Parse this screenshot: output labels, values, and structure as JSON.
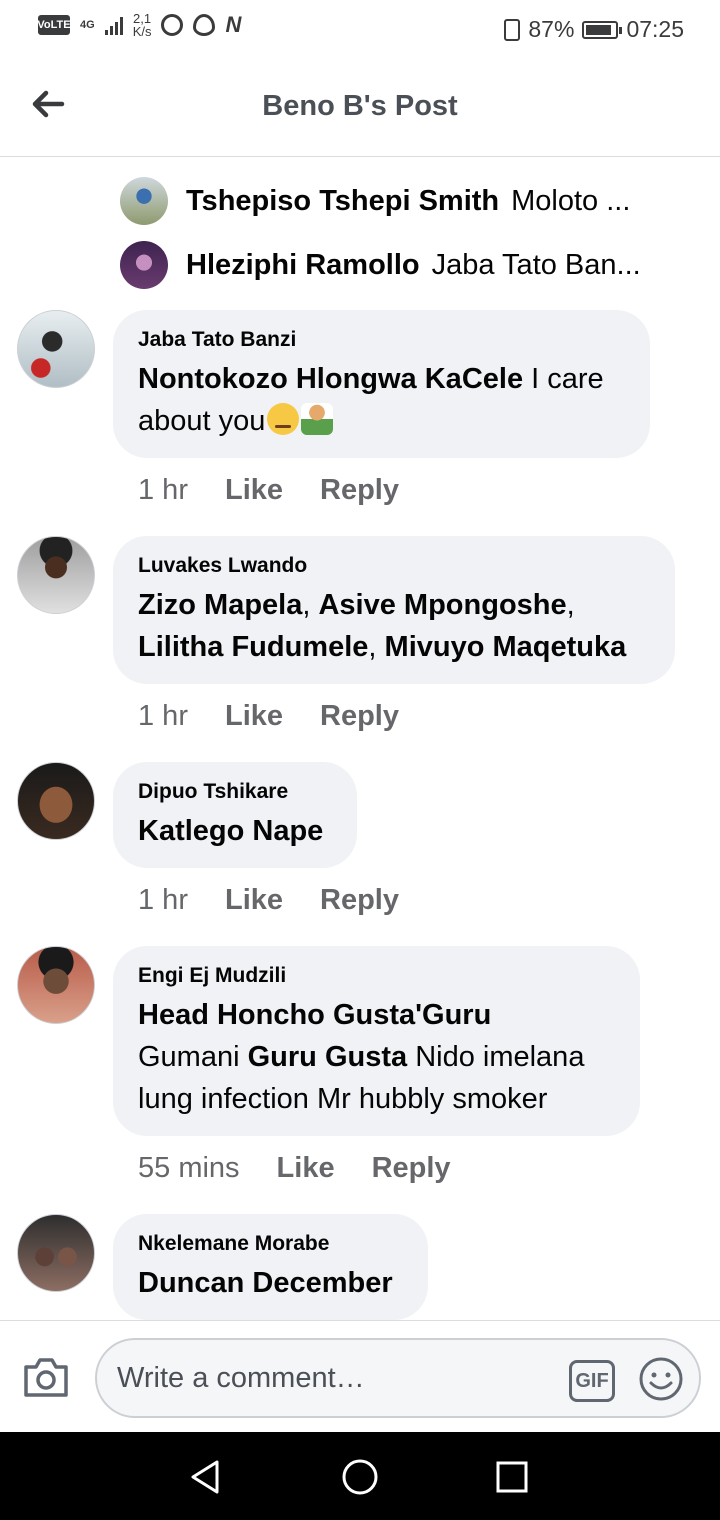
{
  "status_bar": {
    "volte": "VoLTE",
    "network": "4G",
    "speed": "2,1",
    "speed_unit": "K/s",
    "n_label": "N",
    "battery": "87%",
    "time": "07:25"
  },
  "header": {
    "title": "Beno B's Post"
  },
  "reply_previews": [
    {
      "name": "Tshepiso Tshepi Smith",
      "text": "Moloto ..."
    },
    {
      "name": "Hleziphi Ramollo",
      "text": "Jaba Tato Ban..."
    }
  ],
  "comments": [
    {
      "author": "Jaba Tato Banzi",
      "mention": "Nontokozo Hlongwa KaCele",
      "text": "I care about you",
      "time": "1 hr",
      "like": "Like",
      "reply": "Reply"
    },
    {
      "author": "Luvakes Lwando",
      "mentions": [
        "Zizo Mapela",
        "Asive Mpongoshe",
        "Lilitha Fudumele",
        "Mivuyo Maqetuka"
      ],
      "sep": ",",
      "time": "1 hr",
      "like": "Like",
      "reply": "Reply"
    },
    {
      "author": "Dipuo Tshikare",
      "mention": "Katlego Nape",
      "time": "1 hr",
      "like": "Like",
      "reply": "Reply"
    },
    {
      "author": "Engi Ej Mudzili",
      "mention": "Head Honcho Gusta'Guru",
      "text_a": "Gumani",
      "mention_b": "Guru Gusta",
      "text_b": "Nido imelana lung infection Mr hubbly smoker",
      "time": "55 mins",
      "like": "Like",
      "reply": "Reply"
    },
    {
      "author": "Nkelemane Morabe",
      "mention": "Duncan December"
    }
  ],
  "composer": {
    "placeholder": "Write a comment…",
    "gif_label": "GIF"
  },
  "icons": {
    "back": "back-arrow-icon",
    "camera": "camera-icon",
    "emoji": "smiley-icon",
    "nav": [
      "back-triangle-icon",
      "home-circle-icon",
      "recents-square-icon"
    ]
  },
  "colors": {
    "bubble": "#f0f2f5",
    "meta": "#65676b",
    "navbar": "#000000"
  }
}
